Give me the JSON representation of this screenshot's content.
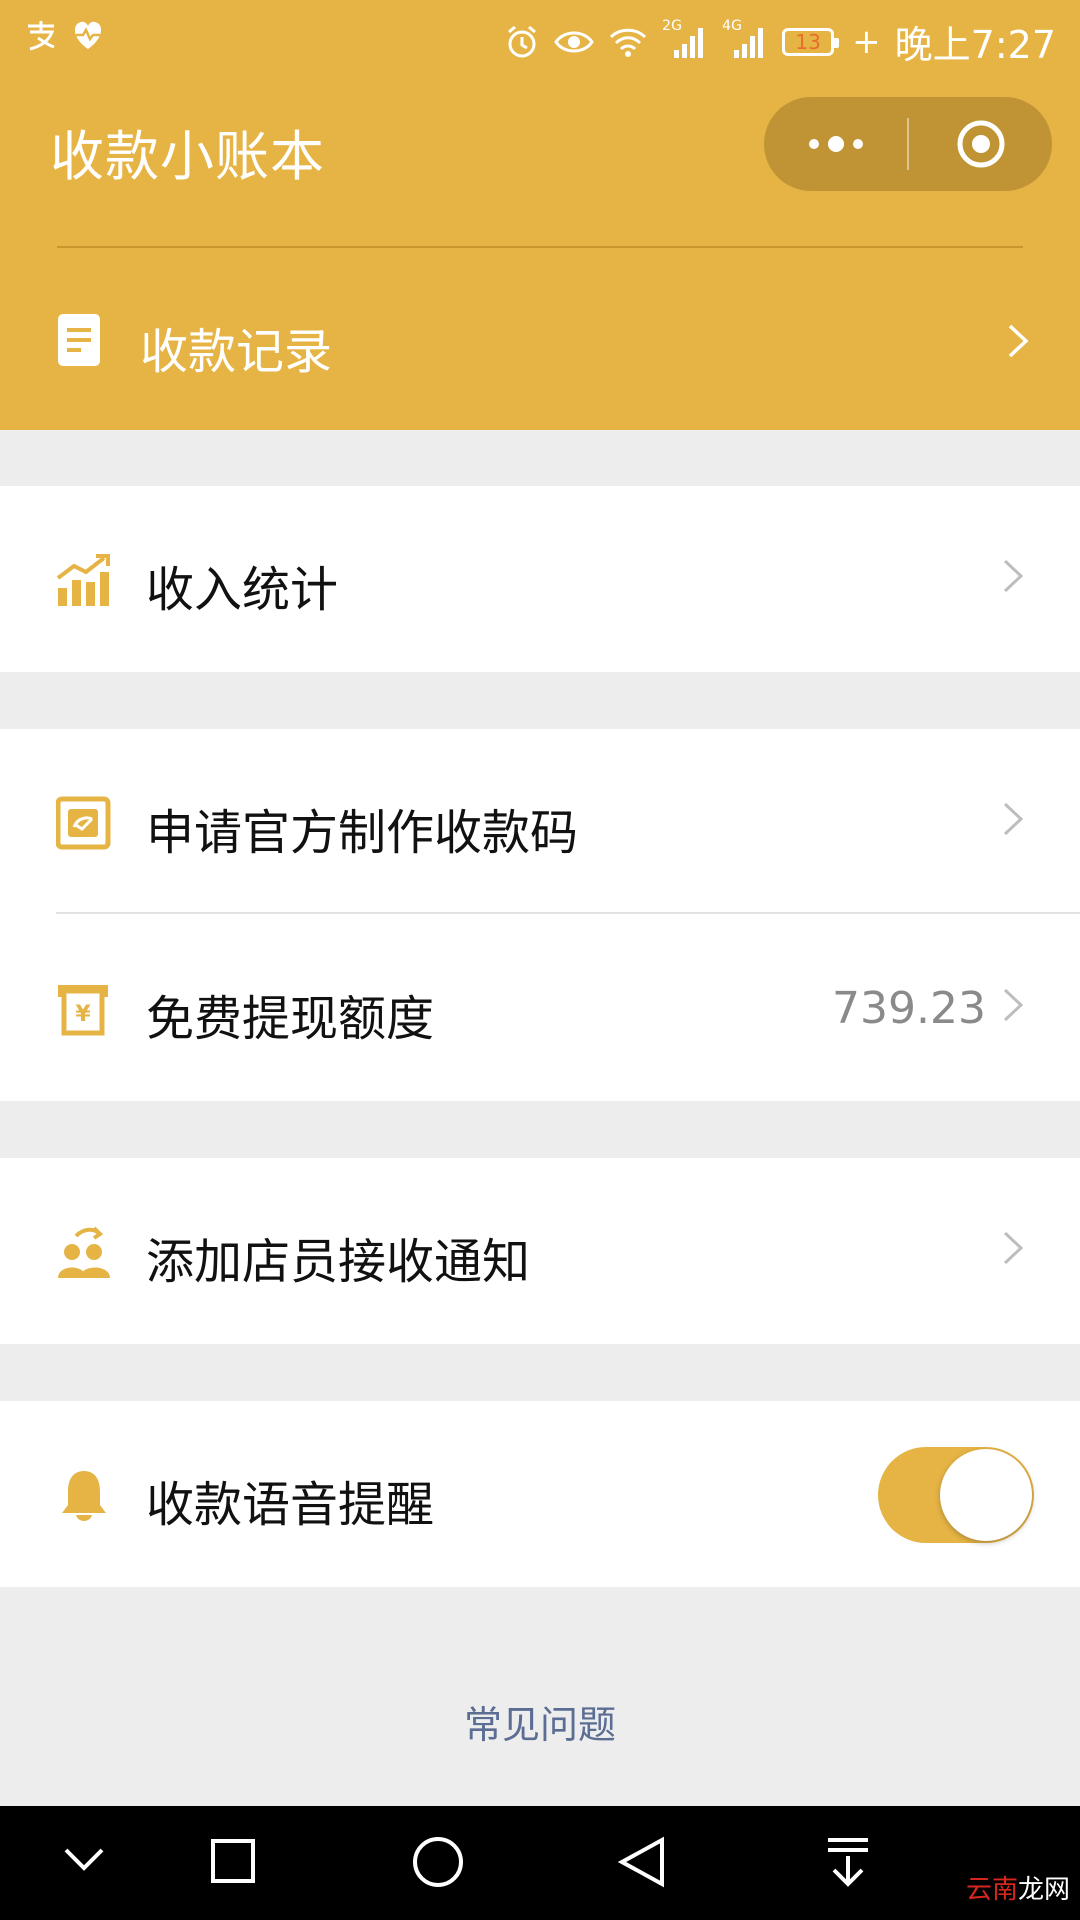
{
  "status_bar": {
    "left_icons": [
      "alipay-icon",
      "heart-rate-icon"
    ],
    "right_icons": [
      "alarm-icon",
      "eye-icon",
      "wifi-icon",
      "signal-2g-icon",
      "signal-4g-icon",
      "battery-icon",
      "charging-icon"
    ],
    "network_2g": "2G",
    "network_4g": "4G",
    "battery_level": "13",
    "plus": "+",
    "time": "晚上7:27"
  },
  "header": {
    "title": "收款小账本",
    "capsule": {
      "more_icon": "more-dots-icon",
      "close_icon": "target-close-icon"
    },
    "record_row": {
      "label": "收款记录",
      "icon": "document-icon"
    }
  },
  "menu": {
    "income_stats": {
      "label": "收入统计",
      "icon": "bar-chart-icon"
    },
    "apply_code": {
      "label": "申请官方制作收款码",
      "icon": "qr-card-icon"
    },
    "free_withdraw": {
      "label": "免费提现额度",
      "value": "739.23",
      "icon": "yuan-voucher-icon"
    },
    "add_staff": {
      "label": "添加店员接收通知",
      "icon": "staff-icon"
    },
    "voice_reminder": {
      "label": "收款语音提醒",
      "icon": "bell-icon",
      "enabled": true
    }
  },
  "faq": {
    "label": "常见问题"
  },
  "watermark": {
    "part1": "云南",
    "part2": "龙网"
  },
  "colors": {
    "accent": "#e6b445",
    "background": "#ededed",
    "link": "#5b6d93",
    "value_gray": "#8a8a8a"
  }
}
